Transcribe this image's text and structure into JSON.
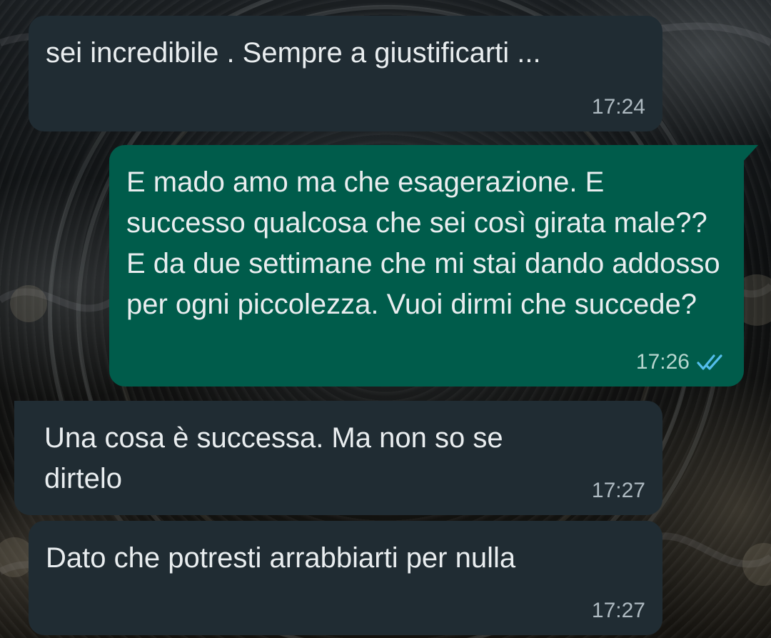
{
  "messages": [
    {
      "direction": "incoming",
      "text": "sei incredibile . Sempre a giustificarti ...",
      "time": "17:24"
    },
    {
      "direction": "outgoing",
      "text": "E mado amo ma che esagerazione. E successo qualcosa che sei così girata male?? E da due settimane che mi stai dando addosso per ogni piccolezza. Vuoi dirmi che succede?",
      "time": "17:26",
      "status_icon": "double-check-icon",
      "status_color": "#53bdeb"
    },
    {
      "direction": "incoming",
      "text": "Una cosa è successa. Ma non so se dirtelo",
      "time": "17:27"
    },
    {
      "direction": "incoming",
      "text": "Dato che potresti arrabbiarti per nulla",
      "time": "17:27"
    }
  ],
  "colors": {
    "incoming_bubble": "#202c33",
    "outgoing_bubble": "#005c4b",
    "text": "#e9edef",
    "timestamp": "#aebac1",
    "read_ticks": "#53bdeb"
  }
}
